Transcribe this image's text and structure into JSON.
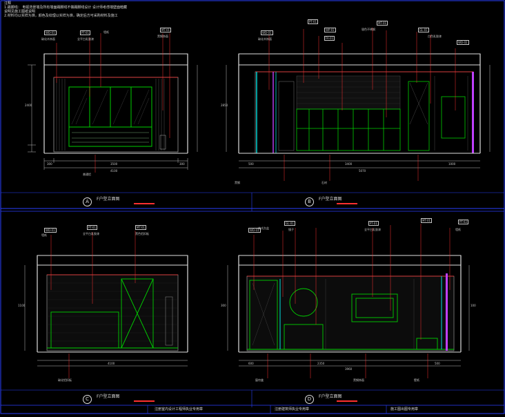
{
  "notes": {
    "title": "注释",
    "lines": [
      "1.踢脚线：  电视背景墙及所有墙面踢脚线不做踢脚线设计    设计师考虑墙壁面暗藏",
      "说明见施工图纸说明",
      "2.材料均以实样为准，颜色及纹理以实样为准，确定后方可采购材料及施工"
    ]
  },
  "views": [
    {
      "id": "A",
      "title": "F户型立面图"
    },
    {
      "id": "B",
      "title": "F户型立面图"
    },
    {
      "id": "C",
      "title": "F户型立面图"
    },
    {
      "id": "D",
      "title": "F户型立面图"
    }
  ],
  "title_block": [
    "注册室内设计工程师执业专用章",
    "注册建筑师执业专用章",
    "施工图出图专用章"
  ],
  "tags": [
    "WD-01",
    "PT-01",
    "ST-01",
    "MT-01",
    "WP-01",
    "GL-01",
    "FA-01",
    "WD-02",
    "PT-02"
  ],
  "labels_a": [
    "墙纸",
    "全平白乳胶漆",
    "碳化木饰面",
    "普通铝",
    "黑钢饰面"
  ],
  "labels_b": [
    "银色不锈钢",
    "碳化木饰面",
    "黑钢",
    "白色乳胶漆",
    "石材"
  ],
  "labels_c": [
    "墙纸",
    "全平白乳胶漆",
    "黑色铝扣板",
    "碳化铝扣板"
  ],
  "labels_d": [
    "一体式台盆",
    "镜子",
    "全平白乳胶漆",
    "墙纸",
    "壁纸",
    "黑钢饰面",
    "窗帘盒"
  ],
  "dims_a": [
    "300",
    "3500",
    "300",
    "4100"
  ],
  "dims_b": [
    "500",
    "3400",
    "1000",
    "5070"
  ],
  "dims_c": [
    "4100"
  ],
  "dims_d": [
    "600",
    "2350",
    "500",
    "3960"
  ],
  "heights": [
    "2400",
    "2850",
    "1100",
    "300",
    "100"
  ]
}
